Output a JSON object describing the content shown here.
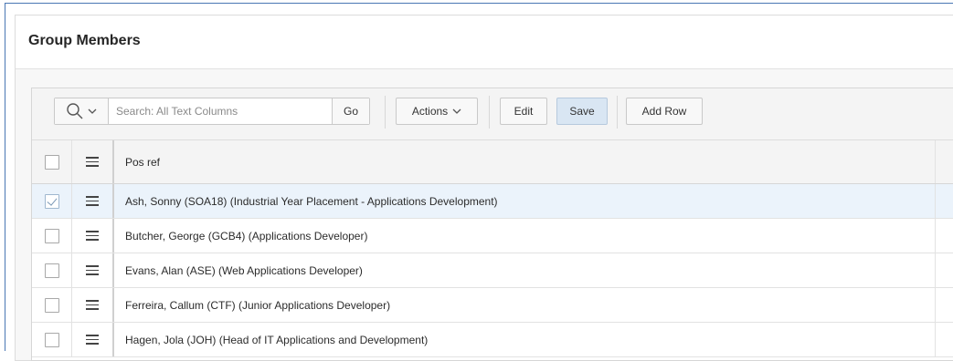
{
  "region": {
    "title": "Group Members"
  },
  "toolbar": {
    "search_placeholder": "Search: All Text Columns",
    "go_label": "Go",
    "actions_label": "Actions",
    "edit_label": "Edit",
    "save_label": "Save",
    "add_row_label": "Add Row"
  },
  "grid": {
    "columns": [
      "Pos ref"
    ],
    "rows": [
      {
        "pos_ref": "Ash, Sonny (SOA18) (Industrial Year Placement - Applications Development)",
        "selected": true
      },
      {
        "pos_ref": "Butcher, George (GCB4) (Applications Developer)",
        "selected": false
      },
      {
        "pos_ref": "Evans, Alan (ASE) (Web Applications Developer)",
        "selected": false
      },
      {
        "pos_ref": "Ferreira, Callum (CTF) (Junior Applications Developer)",
        "selected": false
      },
      {
        "pos_ref": "Hagen, Jola (JOH) (Head of IT Applications and Development)",
        "selected": false
      }
    ]
  },
  "colors": {
    "accent": "#4a77b4",
    "selected_row": "#ebf3fb",
    "save_button": "#d9e6f3"
  }
}
